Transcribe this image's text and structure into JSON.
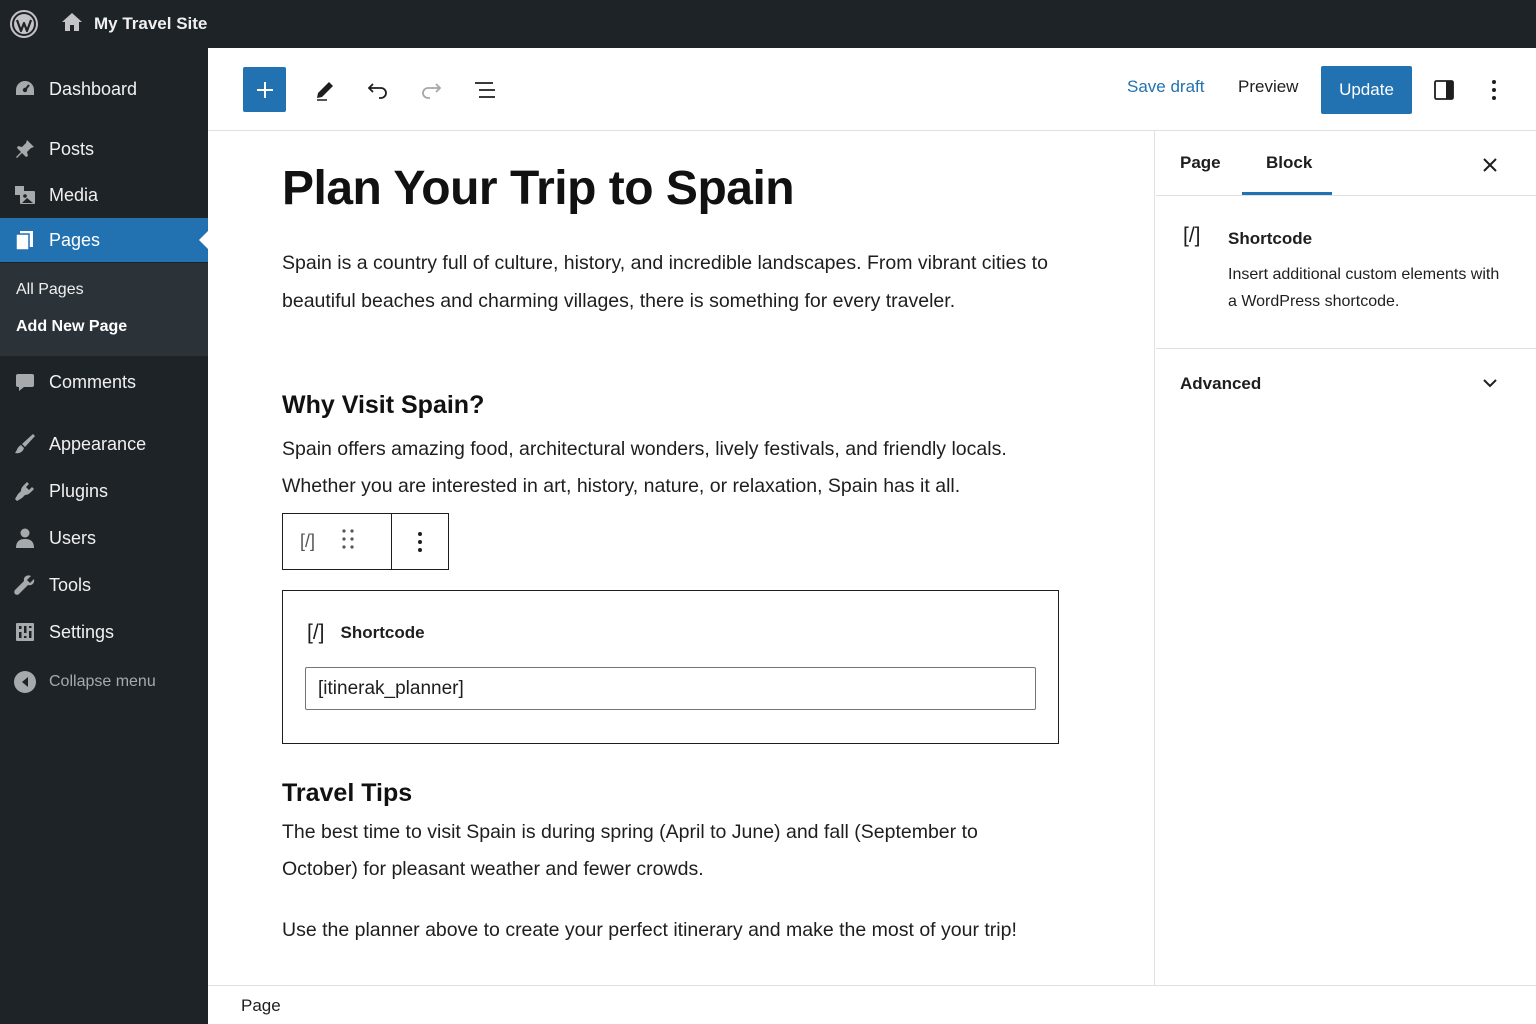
{
  "admin_bar": {
    "site_name": "My Travel Site"
  },
  "sidebar": {
    "items": [
      {
        "label": "Dashboard",
        "icon": "dashboard-icon"
      },
      {
        "label": "Posts",
        "icon": "pin-icon"
      },
      {
        "label": "Media",
        "icon": "media-icon"
      },
      {
        "label": "Pages",
        "icon": "pages-icon"
      },
      {
        "label": "Comments",
        "icon": "comment-icon"
      },
      {
        "label": "Appearance",
        "icon": "brush-icon"
      },
      {
        "label": "Plugins",
        "icon": "plug-icon"
      },
      {
        "label": "Users",
        "icon": "user-icon"
      },
      {
        "label": "Tools",
        "icon": "wrench-icon"
      },
      {
        "label": "Settings",
        "icon": "settings-icon"
      }
    ],
    "submenu": [
      "All Pages",
      "Add New Page"
    ],
    "collapse_label": "Collapse menu",
    "active_item": "Pages"
  },
  "toolbar": {
    "save_draft": "Save draft",
    "preview": "Preview",
    "update": "Update"
  },
  "content": {
    "title": "Plan Your Trip to Spain",
    "intro": "Spain is a country full of culture, history, and incredible landscapes. From vibrant cities to beautiful beaches and charming villages, there is something for every traveler.",
    "heading_why": "Why Visit Spain?",
    "why_text": "Spain offers amazing food, architectural wonders, lively festivals, and friendly locals. Whether you are interested in art, history, nature, or relaxation, Spain has it all.",
    "block_toolbar_glyph": "[/]",
    "shortcode_label": "Shortcode",
    "shortcode_glyph": "[/]",
    "shortcode_value": "[itinerak_planner]",
    "heading_tips": "Travel Tips",
    "tips_text": "The best time to visit Spain is during spring (April to June) and fall (September to October) for pleasant weather and fewer crowds.",
    "closing_text": "Use the planner above to create your perfect itinerary and make the most of your trip!"
  },
  "settings_panel": {
    "tabs": [
      "Page",
      "Block"
    ],
    "active_tab": "Block",
    "block_glyph": "[/]",
    "block_title": "Shortcode",
    "block_description": "Insert additional custom elements with a WordPress shortcode.",
    "advanced_label": "Advanced"
  },
  "footer": {
    "breadcrumb": "Page"
  },
  "colors": {
    "admin_dark": "#1d2327",
    "accent_blue": "#2271b1",
    "submenu_bg": "#2c3338"
  }
}
